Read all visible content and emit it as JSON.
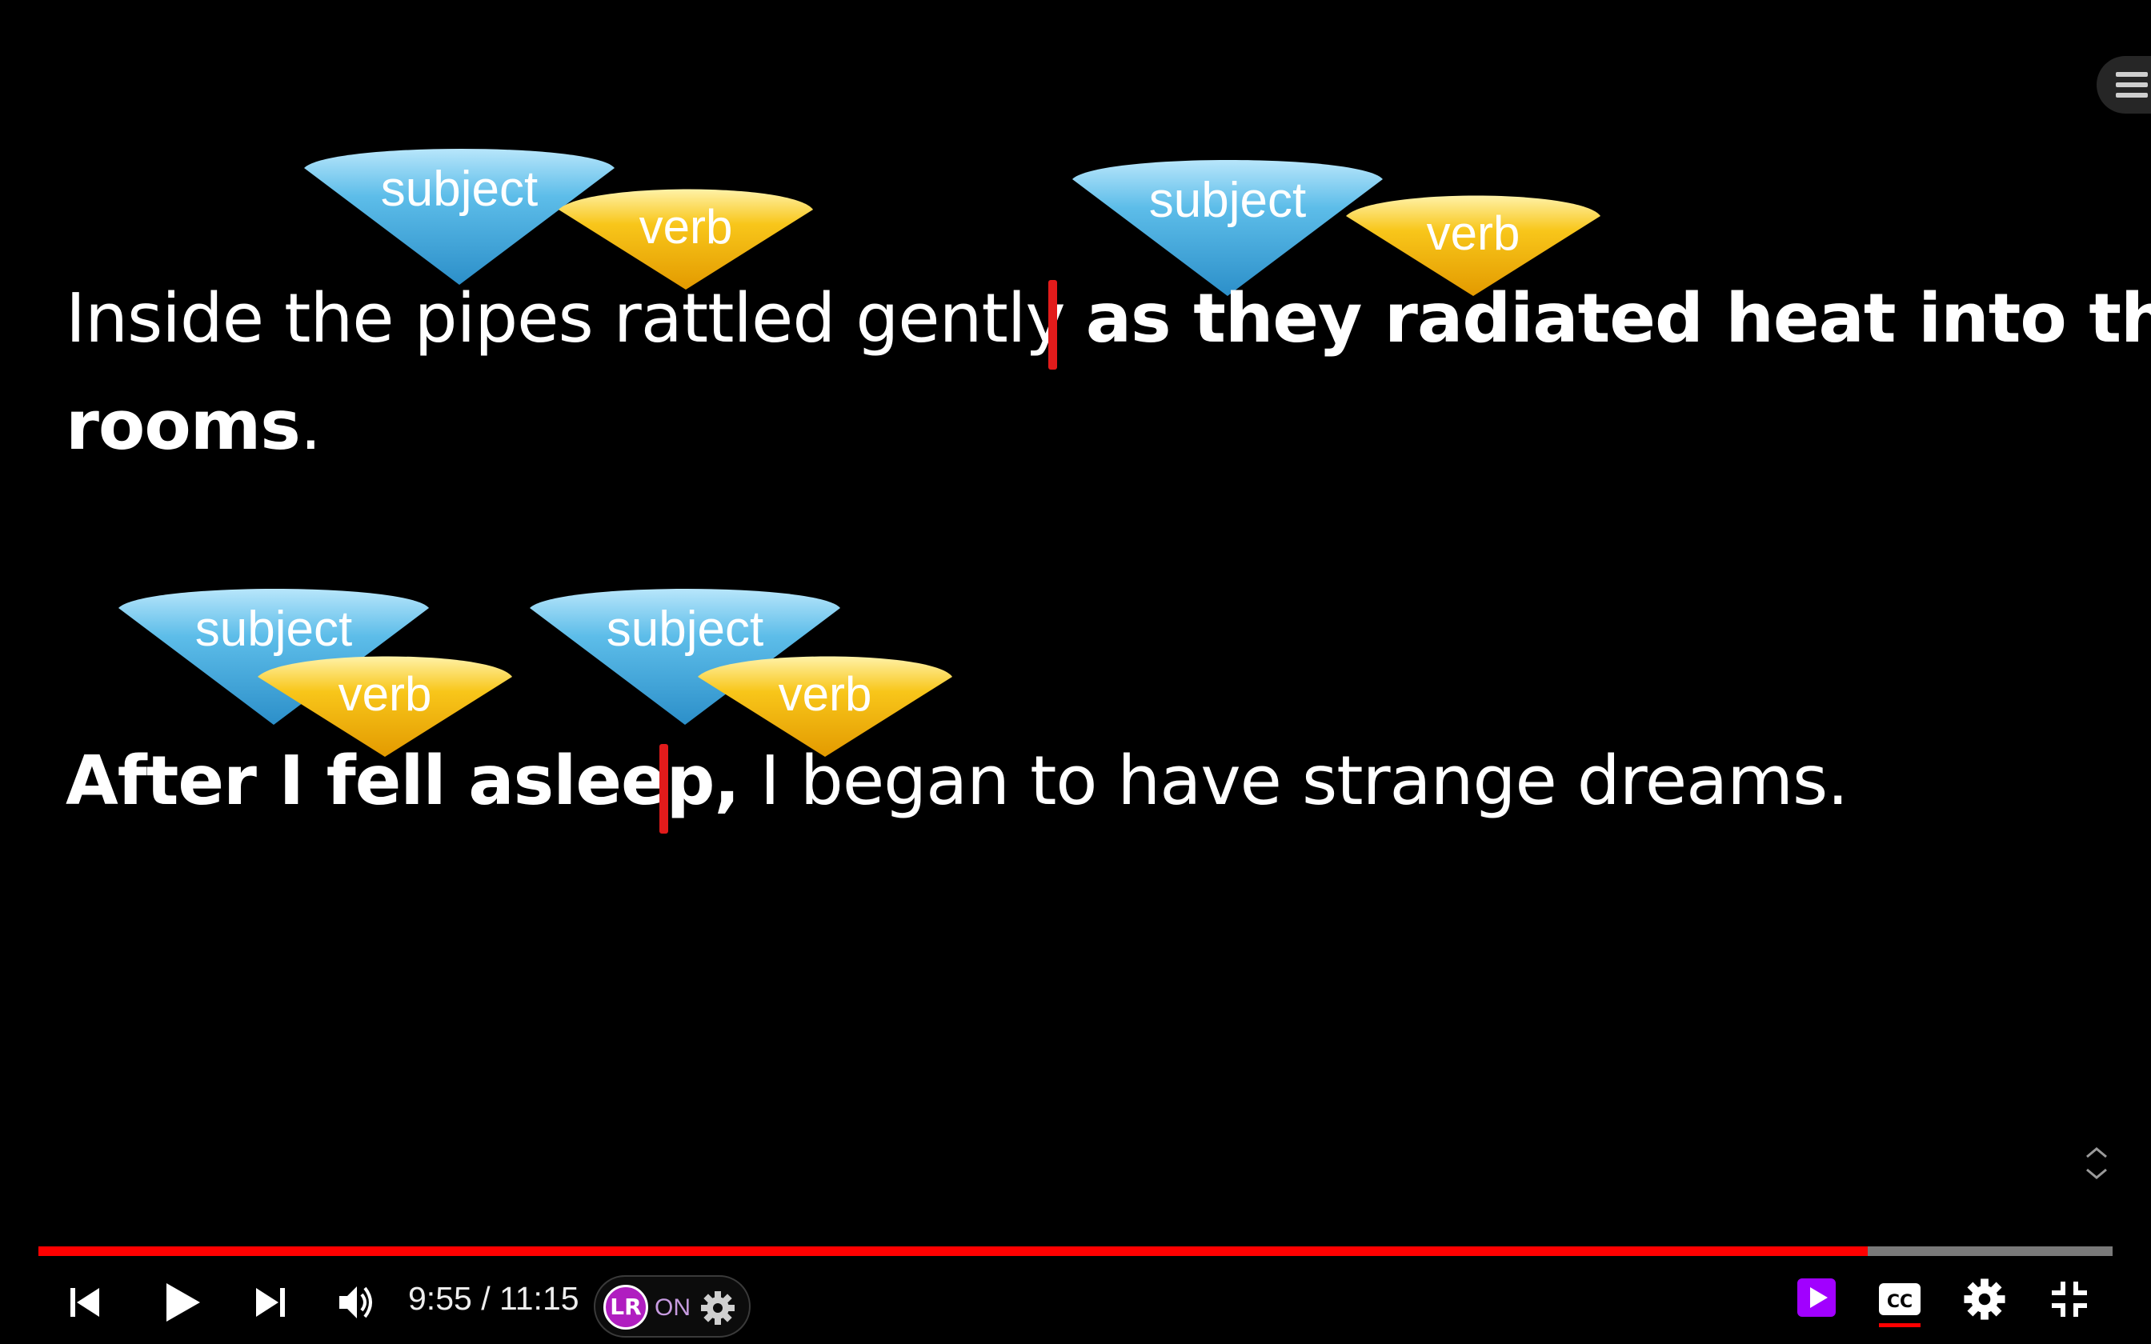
{
  "video": {
    "sentence1": {
      "normal": "Inside the pipes rattled gently",
      "bold": "as they radiated heat into the",
      "bold_continued": "rooms",
      "end": "."
    },
    "sentence2": {
      "bold": "After I fell asleep,",
      "normal": "I began to have strange dreams."
    },
    "tags": {
      "subject": "subject",
      "verb": "verb"
    },
    "colors": {
      "subject_tag": "#4fb3e3",
      "verb_tag": "#f6bf0d",
      "clause_marker": "#e21b1b"
    }
  },
  "player": {
    "time_current": "9:55",
    "time_separator": " / ",
    "time_total": "11:15",
    "progress_fraction": 0.882,
    "extension_logo": "LR",
    "extension_state": "ON",
    "progress_color": "#ff0000",
    "icons": [
      "menu-icon",
      "expand-icon",
      "previous-icon",
      "play-icon",
      "next-icon",
      "volume-icon",
      "extension-settings-icon",
      "autoplay-icon",
      "captions-icon",
      "settings-icon",
      "exit-fullscreen-icon"
    ]
  }
}
